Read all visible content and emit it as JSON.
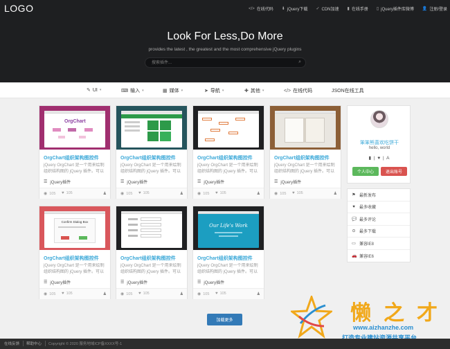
{
  "header": {
    "logo": "LOGO",
    "nav": [
      {
        "icon": "</>",
        "label": "在线代码"
      },
      {
        "icon": "⬇",
        "label": "jQuery下载"
      },
      {
        "icon": "✓",
        "label": "CDN加速"
      },
      {
        "icon": "▮",
        "label": "在线手册"
      },
      {
        "icon": "▯",
        "label": "jQuery插件库微博"
      },
      {
        "icon": "👤",
        "label": "注册/登录"
      }
    ],
    "headline": "Look For Less,Do More",
    "subline": "provides the latest , the greatest and the most comprehensive jQuery plugins",
    "search_placeholder": "搜索插件..."
  },
  "categories": [
    {
      "icon": "✎",
      "label": "UI"
    },
    {
      "icon": "⌨",
      "label": "输入"
    },
    {
      "icon": "▦",
      "label": "媒体"
    },
    {
      "icon": "➤",
      "label": "导航"
    },
    {
      "icon": "✚",
      "label": "其他"
    },
    {
      "icon": "</>",
      "label": "在线代码"
    },
    {
      "icon": "",
      "label": "JSON在线工具"
    }
  ],
  "cards": [
    {
      "title": "OrgChart组织架构图控件",
      "desc": "jQuery OrgChart 是一个用来绘制组织结构图的 jQuery 插件。可以",
      "category": "jQuery插件",
      "views": "105",
      "likes": "105",
      "thumb_bg": "#a02f6f"
    },
    {
      "title": "OrgChart组织架构图控件",
      "desc": "jQuery OrgChart 是一个用来绘制组织结构图的 jQuery 插件。可以",
      "category": "jQuery插件",
      "views": "105",
      "likes": "105",
      "thumb_bg": "#25545c"
    },
    {
      "title": "OrgChart组织架构图控件",
      "desc": "jQuery OrgChart 是一个用来绘制组织结构图的 jQuery 插件。可以",
      "category": "jQuery插件",
      "views": "105",
      "likes": "105",
      "thumb_bg": "#1f2022"
    },
    {
      "title": "OrgChart组织架构图控件",
      "desc": "jQuery OrgChart 是一个用来绘制组织结构图的 jQuery 插件。可以",
      "category": "jQuery插件",
      "views": "105",
      "likes": "105",
      "thumb_bg": "#8c5f37"
    },
    {
      "title": "OrgChart组织架构图控件",
      "desc": "jQuery OrgChart 是一个用来绘制组织结构图的 jQuery 插件。可以",
      "category": "jQuery插件",
      "views": "105",
      "likes": "105",
      "thumb_bg": "#d9575c"
    },
    {
      "title": "OrgChart组织架构图控件",
      "desc": "jQuery OrgChart 是一个用来绘制组织结构图的 jQuery 插件。可以",
      "category": "jQuery插件",
      "views": "105",
      "likes": "105",
      "thumb_bg": "#1f2022"
    },
    {
      "title": "OrgChart组织架构图控件",
      "desc": "jQuery OrgChart 是一个用来绘制组织结构图的 jQuery 插件。可以",
      "category": "jQuery插件",
      "views": "105",
      "likes": "105",
      "thumb_bg": "#1f2022"
    }
  ],
  "thumb_texts": {
    "orgchart": "OrgChart",
    "confirm": "Confirm Dialog Box",
    "lifes_work": "Our Life's Work"
  },
  "profile": {
    "name": "笨笨熊喜欢吃饼干",
    "hello": "hello, world",
    "icons": "▮ | ♥ | A",
    "center_button": "个人中心",
    "logout_button": "退出账号"
  },
  "sidebar_list": [
    {
      "icon": "⚑",
      "label": "最新发布"
    },
    {
      "icon": "♥",
      "label": "最多收藏"
    },
    {
      "icon": "💬",
      "label": "最多评论"
    },
    {
      "icon": "⊙",
      "label": "最多下载"
    },
    {
      "icon": "▭",
      "label": "兼容IE8"
    },
    {
      "icon": "🚗",
      "label": "兼容IE6"
    }
  ],
  "load_more": "加载更多",
  "watermark": {
    "chars": "懒之才",
    "url": "www.aizhanzhe.com",
    "slogan": "打造专业建站资源共享平台"
  },
  "footer": {
    "links": [
      "在线反馈",
      "帮助中心"
    ],
    "copyright": "Copyright © 2020 服务地域ICP备XXXX号-1"
  }
}
